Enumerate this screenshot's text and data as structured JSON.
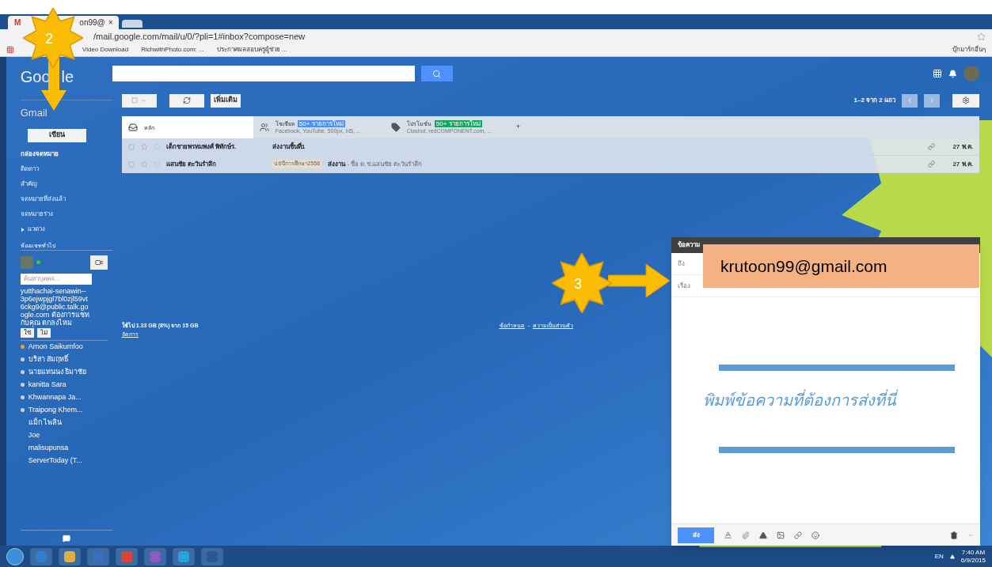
{
  "browser": {
    "tab_icon": "M",
    "tab_title": "on99@",
    "tab_close": "×",
    "address": "/mail.google.com/mail/u/0/?pli=1#inbox?compose=new",
    "bookmarks": [
      "Video Download",
      "RichwithPhoto.com: ...",
      "ประกาศผลสอบครูผู้ช่วย ..."
    ],
    "other_bookmarks": "บุ๊กมาร์กอื่นๆ"
  },
  "header": {
    "logo_parts": [
      "Goo",
      "le"
    ],
    "app": "Gmail"
  },
  "toolbar": {
    "more": "เพิ่มเติม",
    "paging": "1–2 จาก 2 แถว"
  },
  "compose_button": "เขียน",
  "nav": [
    {
      "label": "กล่องจดหมาย",
      "selected": true
    },
    {
      "label": "ติดดาว",
      "selected": false
    },
    {
      "label": "สำคัญ",
      "selected": false
    },
    {
      "label": "จดหมายที่ส่งแล้ว",
      "selected": false
    },
    {
      "label": "จดหมายร่าง",
      "selected": false
    },
    {
      "label": "แวดวง",
      "selected": false,
      "expanded": false
    }
  ],
  "chat": {
    "section": "ห้องแชททั่วไป",
    "search_placeholder": "ค้นหาบุคคล...",
    "invite": "yutthachai-senawin--3p6ejwpjgl7bl0zjl59vt6ckg9@public.talk.google.com ต้องการแชทกับคุณ ตกลงไหม",
    "yes": "ใช่",
    "no": "ไม่",
    "contacts": [
      {
        "name": "Arnon Saikumfoo",
        "color": "#f0a030"
      },
      {
        "name": "บริสา สัมฤทธิ์",
        "color": "#c8d4e4"
      },
      {
        "name": "นายแทนนง ธิมาชัย",
        "color": "#c8d4e4"
      },
      {
        "name": "kanitta Sara",
        "color": "#c8d4e4"
      },
      {
        "name": "Khwannapa Ja...",
        "color": "#c8d4e4"
      },
      {
        "name": "Traipong Khem...",
        "color": "#c8d4e4"
      },
      {
        "name": "แม็ก ไพลิน"
      },
      {
        "name": "Joe"
      },
      {
        "name": "malisupunsa"
      },
      {
        "name": "ServerToday (T..."
      }
    ]
  },
  "tabs": [
    {
      "label": "หลัก",
      "selected": true
    },
    {
      "label": "โซเชียล",
      "selected": false,
      "badge": "50+ รายการใหม่",
      "color": "#4d90fe",
      "sub": "Facebook, YouTube, 500px, hi5, ..."
    },
    {
      "label": "โปรโมชั่น",
      "selected": false,
      "badge": "50+ รายการใหม่",
      "color": "#16a765",
      "sub": "Clashot, redCOMPONENT.com, ..."
    }
  ],
  "add_tab": "+",
  "messages": [
    {
      "sender": "เด็กชายพรหมพงศ์ พิทักษ์ร.",
      "subject": "ส่งงานชิ้นที่1",
      "date": "27 พ.ค."
    },
    {
      "sender": "แสนชัย ตะวันรำลึก",
      "label": "ป.6ปีการศึกษา2558",
      "subject": "ส่งงาน",
      "snippet": " - ชื่อ ด.ช.แสนชัย ตะวันรำลึก",
      "date": "27 พ.ค."
    }
  ],
  "footer": {
    "storage": "ใช้ไป 1.33 GB (8%) จาก 15 GB",
    "manage": "จัดการ",
    "terms": "ข้อกำหนด",
    "separator": "-",
    "privacy": "ความเป็นส่วนตัว"
  },
  "compose": {
    "title": "ข้อความ",
    "to_label": "ถึง",
    "subject_label": "เรื่อง",
    "send": "ส่ง"
  },
  "annotations": {
    "step_a": "2",
    "step_b": "3",
    "email": "krutoon99@gmail.com",
    "body_hint": "พิมพ์ข้อความที่ต้องการส่งที่นี่"
  },
  "taskbar": {
    "language": "EN",
    "time": "7:40 AM",
    "date": "6/9/2015"
  }
}
